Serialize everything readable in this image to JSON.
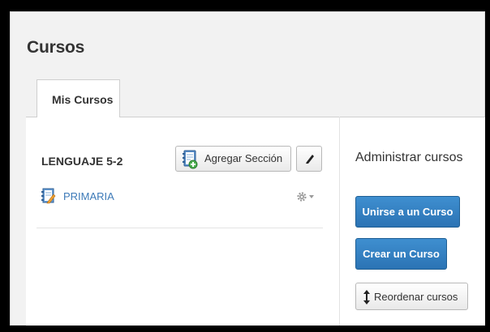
{
  "page": {
    "title": "Cursos"
  },
  "tabs": [
    {
      "label": "Mis Cursos",
      "active": true
    }
  ],
  "course": {
    "name": "LENGUAJE 5-2",
    "add_section_label": "Agregar Sección",
    "sections": [
      {
        "label": "PRIMARIA"
      }
    ]
  },
  "admin": {
    "title": "Administrar cursos",
    "join_label": "Unirse a un Curso",
    "create_label": "Crear un Curso",
    "reorder_label": "Reordenar cursos"
  },
  "colors": {
    "link": "#3d7ab8",
    "primary_button": "#3580c2",
    "background": "#f2f2f2"
  },
  "icons": {
    "add_section": "notebook-plus-icon",
    "edit": "pencil-icon",
    "section": "notebook-pencil-icon",
    "settings": "gear-dropdown-icon",
    "reorder": "vertical-arrows-icon"
  }
}
